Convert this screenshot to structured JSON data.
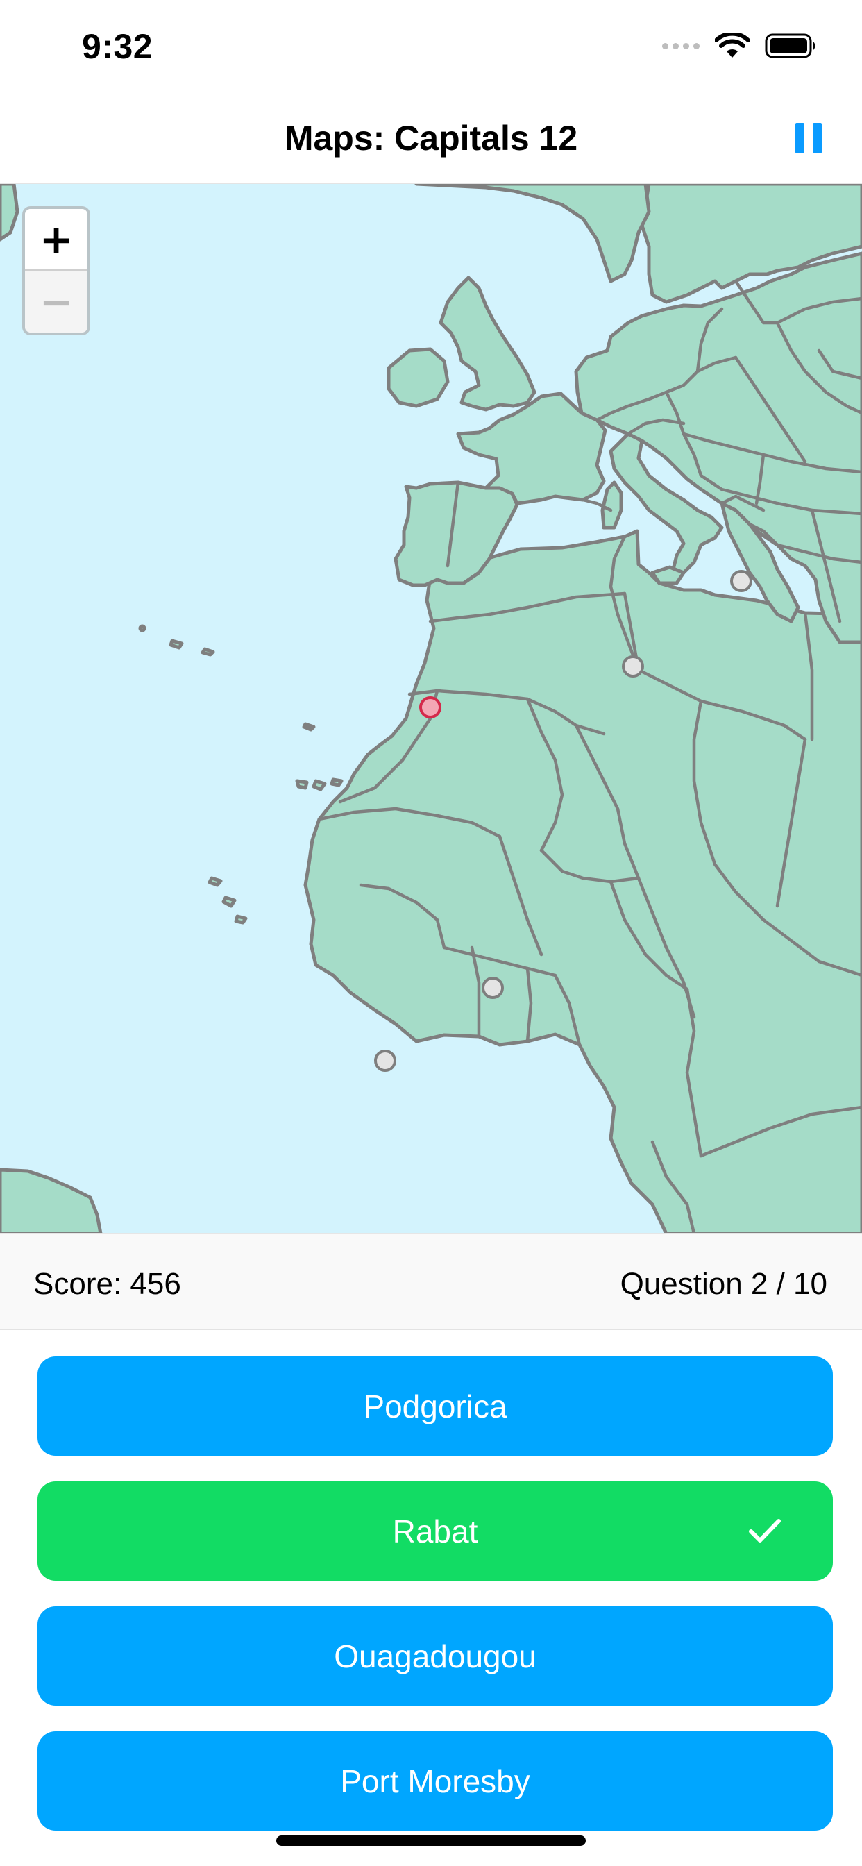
{
  "status_bar": {
    "time": "9:32",
    "icons": [
      "cellular-signal-icon",
      "wifi-icon",
      "battery-icon"
    ]
  },
  "nav": {
    "title": "Maps: Capitals 12",
    "pause_icon": "pause-icon"
  },
  "map": {
    "zoom_in_label": "+",
    "zoom_out_label": "−",
    "colors": {
      "water": "#d3f3fd",
      "land": "#a5dcc8",
      "border": "#7f7f7f",
      "selected_marker": "#d42a4b"
    }
  },
  "score": {
    "score_text": "Score: 456",
    "question_text": "Question 2 / 10"
  },
  "answers": [
    {
      "label": "Podgorica",
      "state": "default"
    },
    {
      "label": "Rabat",
      "state": "correct"
    },
    {
      "label": "Ouagadougou",
      "state": "default"
    },
    {
      "label": "Port Moresby",
      "state": "default"
    }
  ],
  "colors": {
    "accent": "#0a9bff",
    "answer_default": "#00a6ff",
    "answer_correct": "#12dc64"
  }
}
